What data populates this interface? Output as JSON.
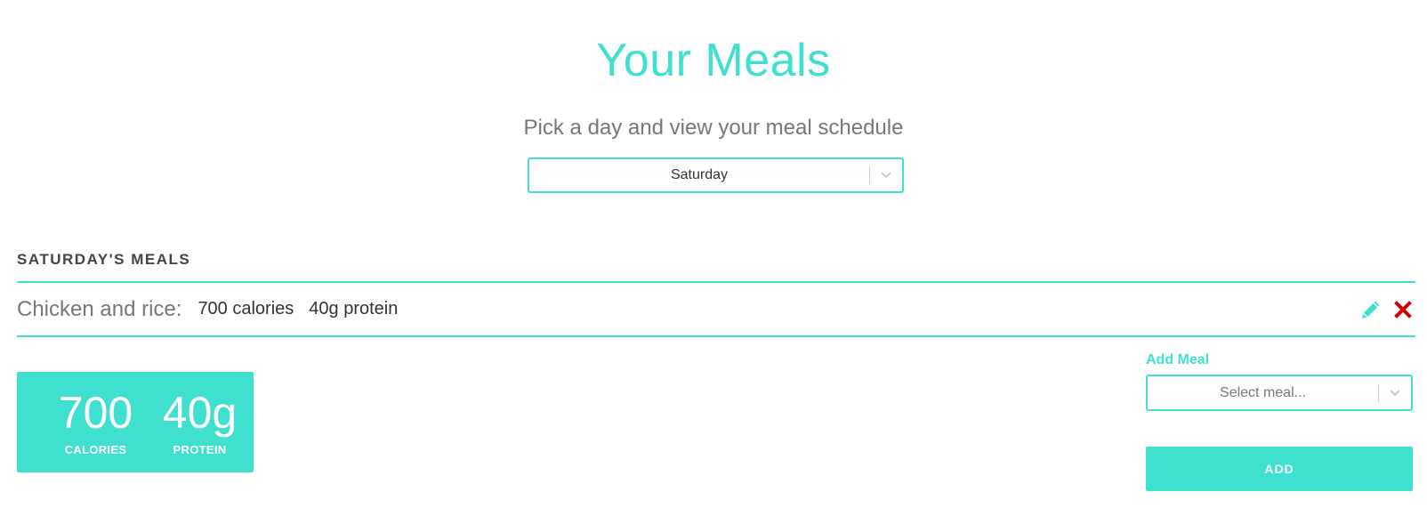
{
  "header": {
    "title": "Your Meals",
    "subtitle": "Pick a day and view your meal schedule"
  },
  "day_picker": {
    "selected": "Saturday"
  },
  "meals_section": {
    "heading": "SATURDAY'S MEALS",
    "items": [
      {
        "name": "Chicken and rice:",
        "calories": "700 calories",
        "protein": "40g protein"
      }
    ]
  },
  "summary": {
    "calories_value": "700",
    "calories_label": "CALORIES",
    "protein_value": "40g",
    "protein_label": "PROTEIN"
  },
  "add_meal": {
    "label": "Add Meal",
    "placeholder": "Select meal...",
    "button_label": "ADD"
  },
  "colors": {
    "accent": "#40e0d0",
    "delete": "#d40000"
  },
  "icons": {
    "edit": "pencil-icon",
    "delete": "close-icon",
    "dropdown": "chevron-down-icon"
  }
}
